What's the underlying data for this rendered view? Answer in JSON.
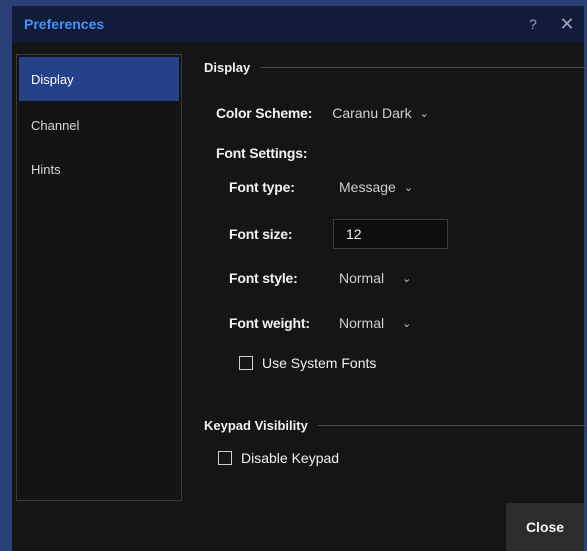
{
  "window": {
    "title": "Preferences",
    "help_glyph": "?",
    "close_glyph": "✕"
  },
  "sidebar": {
    "items": [
      {
        "label": "Display",
        "active": true
      },
      {
        "label": "Channel",
        "active": false
      },
      {
        "label": "Hints",
        "active": false
      }
    ]
  },
  "display": {
    "section_title": "Display",
    "color_scheme": {
      "label": "Color Scheme:",
      "value": "Caranu Dark"
    },
    "font_settings_label": "Font Settings:",
    "font_type": {
      "label": "Font type:",
      "value": "Message"
    },
    "font_size": {
      "label": "Font size:",
      "value": "12"
    },
    "font_style": {
      "label": "Font style:",
      "value": "Normal"
    },
    "font_weight": {
      "label": "Font weight:",
      "value": "Normal"
    },
    "use_system_fonts": {
      "label": "Use System Fonts",
      "checked": false
    }
  },
  "keypad": {
    "section_title": "Keypad Visibility",
    "disable_keypad": {
      "label": "Disable Keypad",
      "checked": false
    }
  },
  "footer": {
    "close_label": "Close"
  },
  "colors": {
    "accent": "#24418a",
    "title_text": "#4a90ff",
    "border": "#2a3f73"
  }
}
